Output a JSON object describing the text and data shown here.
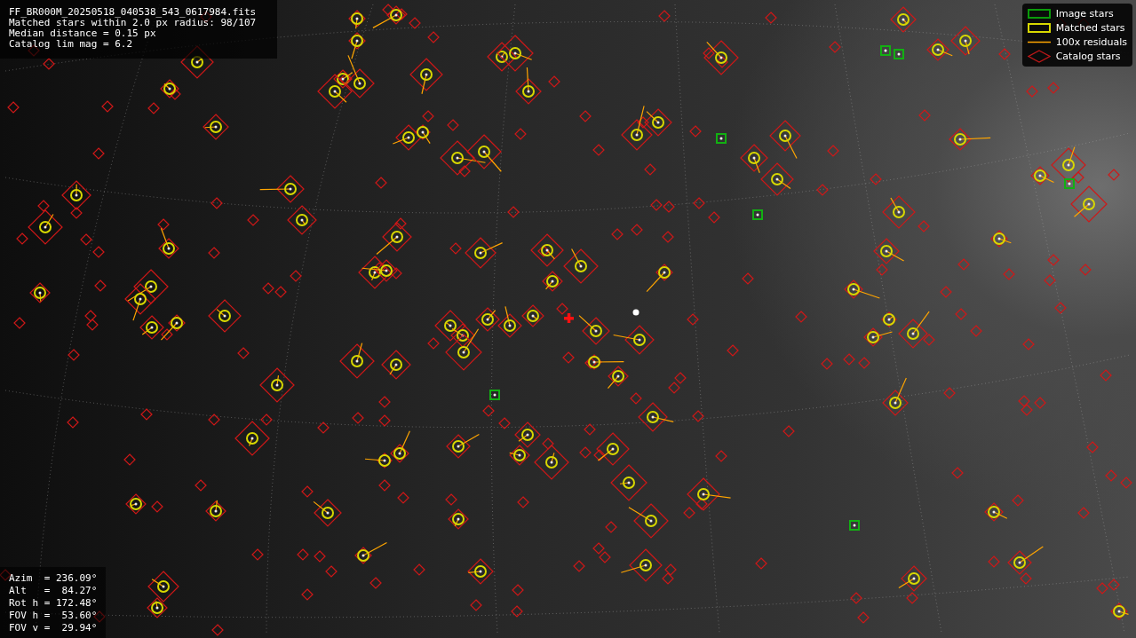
{
  "info": {
    "lines": [
      "FF_BR000M_20250518_040538_543_0617984.fits",
      "Matched stars within 2.0 px radius: 98/107",
      "Median distance = 0.15 px",
      "Catalog lim mag = 6.2"
    ]
  },
  "legend": [
    {
      "kind": "image",
      "label": "Image stars"
    },
    {
      "kind": "matched",
      "label": "Matched stars"
    },
    {
      "kind": "residual",
      "label": "100x residuals"
    },
    {
      "kind": "catalog",
      "label": "Catalog stars"
    }
  ],
  "pointing": {
    "lines": [
      "Azim  = 236.09°",
      "Alt   =  84.27°",
      "Rot h = 172.48°",
      "FOV h =  53.60°",
      "FOV v =  29.94°"
    ]
  }
}
